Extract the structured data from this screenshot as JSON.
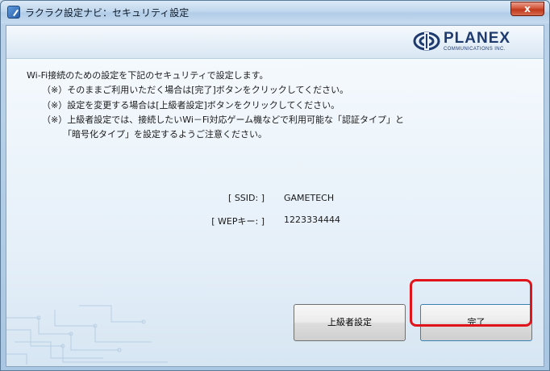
{
  "window": {
    "title": "ラクラク設定ナビ：セキュリティ設定",
    "close_label": "x"
  },
  "brand": {
    "name": "PLANEX",
    "sub": "COMMUNICATIONS INC.",
    "color": "#1e3a6e"
  },
  "instructions": {
    "line1": "Wi-Fi接続のための設定を下記のセキュリティで設定します。",
    "line2": "（※）そのままご利用いただく場合は[完了]ボタンをクリックしてください。",
    "line3": "（※）設定を変更する場合は[上級者設定]ボタンをクリックしてください。",
    "line4": "（※）上級者設定では、接続したいWi－Fi対応ゲーム機などで利用可能な「認証タイプ」と",
    "line5": "「暗号化タイプ」を設定するようご注意ください。"
  },
  "settings": {
    "ssid_label": "[ SSID: ]",
    "ssid_value": "GAMETECH",
    "wep_label": "[ WEPキー: ]",
    "wep_value": "1223334444"
  },
  "buttons": {
    "advanced": "上級者設定",
    "done": "完了"
  },
  "colors": {
    "highlight": "#e0141a",
    "close": "#c0391c"
  }
}
